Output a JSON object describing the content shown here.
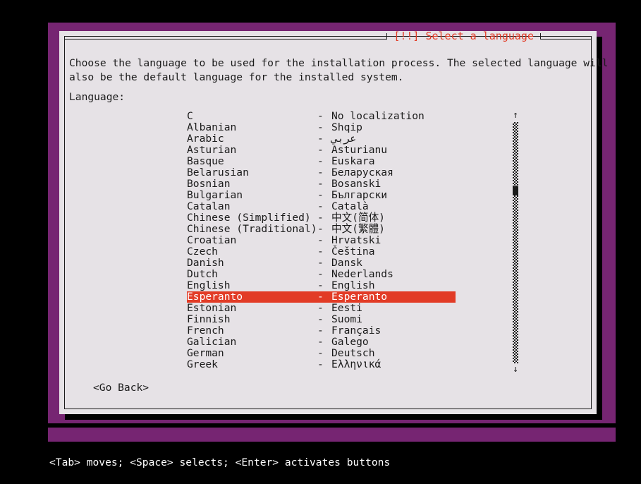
{
  "screen": {
    "backdrop_color": "#762572",
    "dialog_bg_color": "#e6e2e6",
    "accent_color": "#e23b26",
    "text_color": "#1b1b1b"
  },
  "dialog": {
    "title": "[!!] Select a language",
    "description_line_1": "Choose the language to be used for the installation process. The selected language will",
    "description_line_2": "also be the default language for the installed system.",
    "language_label": "Language:",
    "go_back_label": "<Go Back>"
  },
  "language_list": {
    "dash": "-",
    "selected_index": 16,
    "items": [
      {
        "english": "C",
        "native": "No localization"
      },
      {
        "english": "Albanian",
        "native": "Shqip"
      },
      {
        "english": "Arabic",
        "native": "عربي"
      },
      {
        "english": "Asturian",
        "native": "Asturianu"
      },
      {
        "english": "Basque",
        "native": "Euskara"
      },
      {
        "english": "Belarusian",
        "native": "Беларуская"
      },
      {
        "english": "Bosnian",
        "native": "Bosanski"
      },
      {
        "english": "Bulgarian",
        "native": "Български"
      },
      {
        "english": "Catalan",
        "native": "Català"
      },
      {
        "english": "Chinese (Simplified)",
        "native": "中文(简体)"
      },
      {
        "english": "Chinese (Traditional)",
        "native": "中文(繁體)"
      },
      {
        "english": "Croatian",
        "native": "Hrvatski"
      },
      {
        "english": "Czech",
        "native": "Čeština"
      },
      {
        "english": "Danish",
        "native": "Dansk"
      },
      {
        "english": "Dutch",
        "native": "Nederlands"
      },
      {
        "english": "English",
        "native": "English"
      },
      {
        "english": "Esperanto",
        "native": "Esperanto"
      },
      {
        "english": "Estonian",
        "native": "Eesti"
      },
      {
        "english": "Finnish",
        "native": "Suomi"
      },
      {
        "english": "French",
        "native": "Français"
      },
      {
        "english": "Galician",
        "native": "Galego"
      },
      {
        "english": "German",
        "native": "Deutsch"
      },
      {
        "english": "Greek",
        "native": "Ελληνικά"
      }
    ]
  },
  "scrollbar": {
    "up_arrow": "↑",
    "down_arrow": "↓"
  },
  "statusbar": {
    "text": "<Tab> moves; <Space> selects; <Enter> activates buttons"
  }
}
